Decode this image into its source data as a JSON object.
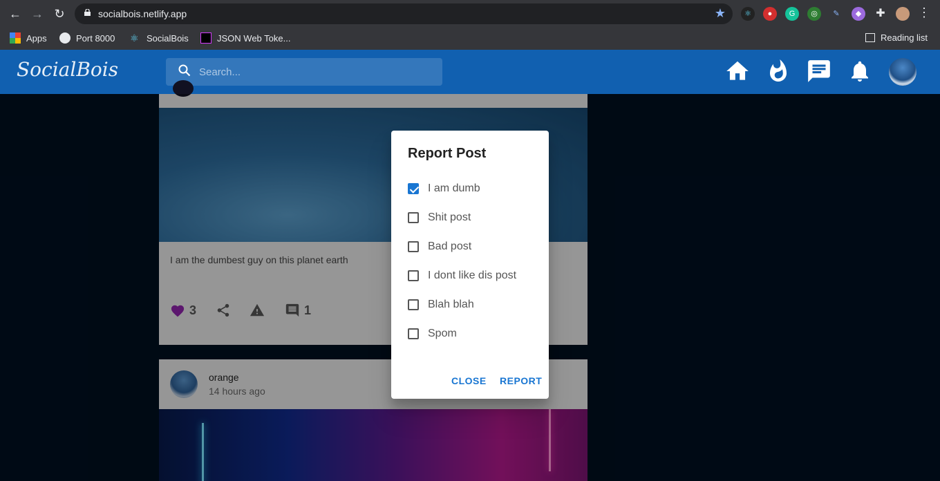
{
  "browser": {
    "url": "socialbois.netlify.app",
    "bookmarks": [
      {
        "label": "Apps"
      },
      {
        "label": "Port 8000"
      },
      {
        "label": "SocialBois"
      },
      {
        "label": "JSON Web Toke..."
      }
    ],
    "reading_list": "Reading list"
  },
  "app": {
    "logo": "SocialBois",
    "search_placeholder": "Search..."
  },
  "post1": {
    "caption": "I am the dumbest guy on this planet earth",
    "likes": "3",
    "comments": "1"
  },
  "post2": {
    "username": "orange",
    "time": "14 hours ago"
  },
  "dialog": {
    "title": "Report Post",
    "options": [
      {
        "label": "I am dumb",
        "checked": true
      },
      {
        "label": "Shit post",
        "checked": false
      },
      {
        "label": "Bad post",
        "checked": false
      },
      {
        "label": "I dont like dis post",
        "checked": false
      },
      {
        "label": "Blah blah",
        "checked": false
      },
      {
        "label": "Spom",
        "checked": false
      }
    ],
    "close_label": "CLOSE",
    "report_label": "REPORT"
  },
  "colors": {
    "accent": "#1976d2",
    "header": "#1160b0",
    "like": "#8e24aa"
  }
}
